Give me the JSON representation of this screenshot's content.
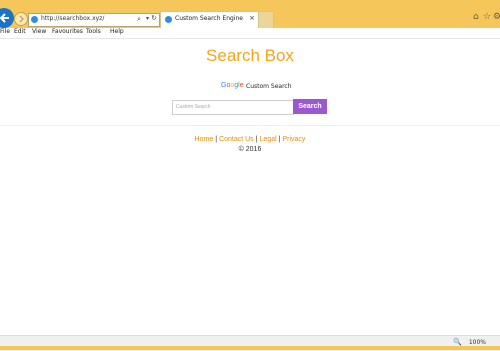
{
  "browser": {
    "url": "http://searchbox.xyz/",
    "tab_title": "Custom Search Engine",
    "tab_close": "×",
    "menu": [
      "File",
      "Edit",
      "View",
      "Favourites",
      "Tools",
      "Help"
    ],
    "zoom": "100%"
  },
  "page": {
    "title": "Search Box",
    "google_label": "Custom Search",
    "search_placeholder": "Custom Search",
    "search_button": "Search",
    "footer": {
      "links": [
        "Home",
        "Contact Us",
        "Legal",
        "Privacy"
      ],
      "copyright": "© 2016"
    }
  },
  "colors": {
    "brand": "#f4a51b",
    "search_button": "#9b59d0",
    "chrome": "#f5c65a"
  }
}
